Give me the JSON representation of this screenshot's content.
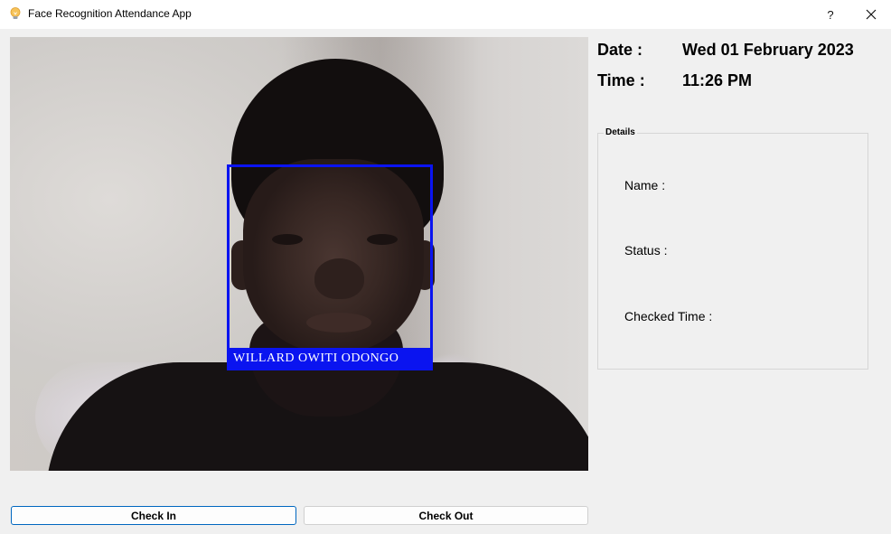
{
  "window": {
    "title": "Face Recognition Attendance App",
    "help_label": "?",
    "icons": {
      "app": "bulb-icon",
      "close": "close-icon"
    }
  },
  "camera": {
    "recognized_name": "WILLARD OWITI ODONGO",
    "box_color": "#0a14f0"
  },
  "datetime": {
    "date_label": "Date :",
    "date_value": "Wed 01 February 2023",
    "time_label": "Time :",
    "time_value": "11:26 PM"
  },
  "details": {
    "group_title": "Details",
    "name_label": "Name :",
    "status_label": "Status :",
    "checked_time_label": "Checked Time :"
  },
  "buttons": {
    "check_in": "Check In",
    "check_out": "Check Out"
  },
  "colors": {
    "accent": "#0067c0",
    "window_bg": "#f0f0f0"
  }
}
